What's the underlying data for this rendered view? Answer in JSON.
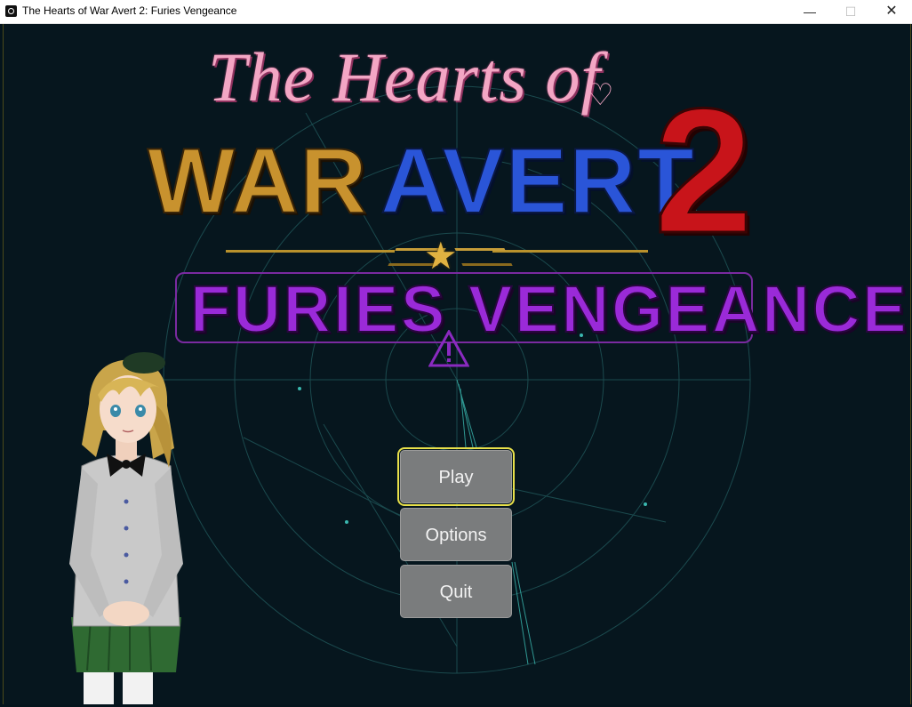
{
  "window": {
    "title": "The Hearts of War Avert 2: Furies Vengeance",
    "minimize_glyph": "—",
    "maximize_glyph": "☐",
    "close_glyph": "✕"
  },
  "logo": {
    "line1": "The Hearts of",
    "line2a": "WAR",
    "line2b": "AVERT",
    "number": "2",
    "subtitle": "FURIES VENGEANCE"
  },
  "icons": {
    "app": "app-icon",
    "heart": "heart-icon",
    "star": "star-icon",
    "warning": "warning-icon"
  },
  "menu": {
    "play": "Play",
    "options": "Options",
    "quit": "Quit",
    "selected": "Play"
  },
  "colors": {
    "background": "#06161e",
    "radar_line": "#2a8a8a",
    "selection": "#e8e04a",
    "button": "#7a7c7d",
    "war": "#c8922e",
    "avert": "#2a55d8",
    "two": "#c8141a",
    "subtitle": "#9a2ad8",
    "script": "#f3a6c4"
  }
}
